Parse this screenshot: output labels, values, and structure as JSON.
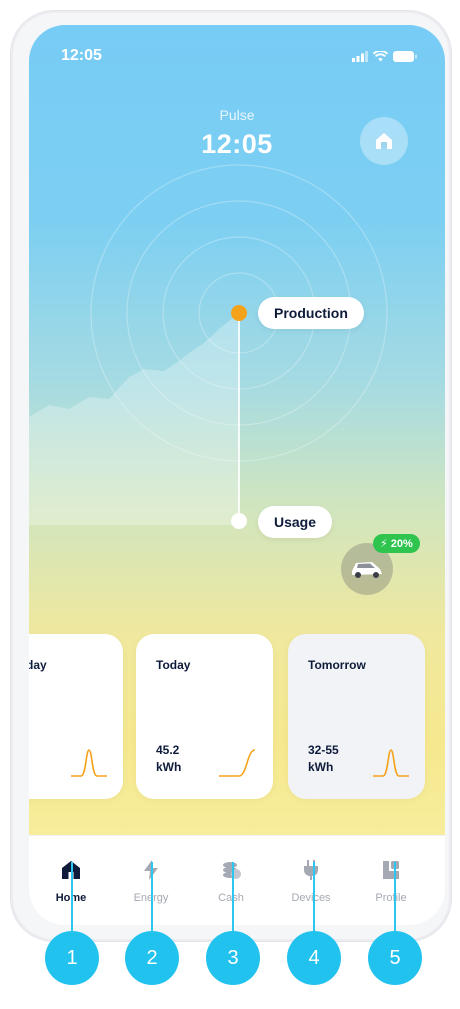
{
  "status": {
    "time": "12:05"
  },
  "header": {
    "label": "Pulse",
    "time": "12:05"
  },
  "graph": {
    "production_label": "Production",
    "usage_label": "Usage"
  },
  "vehicle": {
    "charge": "20%"
  },
  "cards": [
    {
      "title": "day",
      "value_line1": "",
      "value_line2": ""
    },
    {
      "title": "Today",
      "value_line1": "45.2",
      "value_line2": "kWh"
    },
    {
      "title": "Tomorrow",
      "value_line1": "32-55",
      "value_line2": "kWh"
    }
  ],
  "tabs": [
    {
      "label": "Home",
      "icon": "home-icon",
      "active": true
    },
    {
      "label": "Energy",
      "icon": "lightning-icon",
      "active": false
    },
    {
      "label": "Cash",
      "icon": "coins-icon",
      "active": false
    },
    {
      "label": "Devices",
      "icon": "plug-icon",
      "active": false
    },
    {
      "label": "Profile",
      "icon": "profile-icon",
      "active": false
    }
  ],
  "callouts": [
    "1",
    "2",
    "3",
    "4",
    "5"
  ],
  "colors": {
    "accent": "#f5a21b",
    "callout": "#22c2ee",
    "charge": "#2fc44e",
    "text": "#0e1b3a"
  }
}
